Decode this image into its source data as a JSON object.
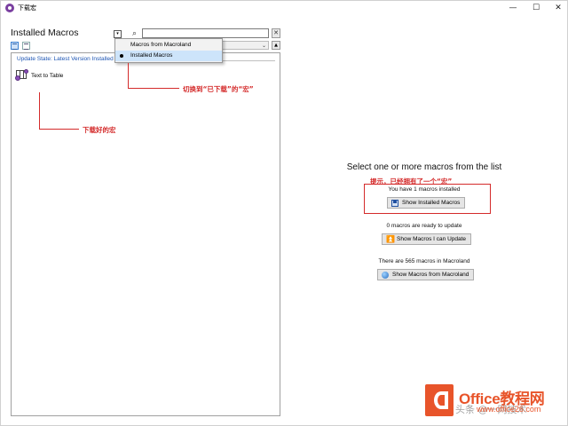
{
  "window": {
    "title": "下载宏",
    "minimize_glyph": "—",
    "maximize_glyph": "☐",
    "close_glyph": "✕"
  },
  "left_pane": {
    "title": "Installed Macros",
    "dropdown_glyph": "▾",
    "search_icon_glyph": "⌕",
    "search_value": "",
    "search_clear_glyph": "✕",
    "sort_arrow_glyph": "⌄",
    "sort_up_glyph": "▲",
    "update_state": "Update State: Latest Version Installed",
    "macros": [
      {
        "label": "Text to Table"
      }
    ]
  },
  "dropdown_menu": {
    "items": [
      {
        "label": "Macros from Macroland",
        "selected": false
      },
      {
        "label": "Installed Macros",
        "selected": true
      }
    ]
  },
  "annotations": {
    "switch_note": "切换到“已下载”的“宏”",
    "downloaded_note": "下载好的宏",
    "hint_note": "提示，已经拥有了一个“宏”",
    "color": "#d42b2b"
  },
  "right_pane": {
    "title": "Select one or more macros from the list",
    "installed_count_text": "You have 1 macros installed",
    "show_installed_label": "Show Installed Macros",
    "update_count_text": "0 macros are ready to update",
    "show_update_label": "Show Macros I can Update",
    "macroland_count_text": "There are 565 macros in Macroland",
    "show_macroland_label": "Show Macros from Macroland"
  },
  "watermark": {
    "brand": "Office教程网",
    "url": "www.office26.com",
    "chinese": "头条 @一网技术",
    "color": "#e8542a"
  }
}
